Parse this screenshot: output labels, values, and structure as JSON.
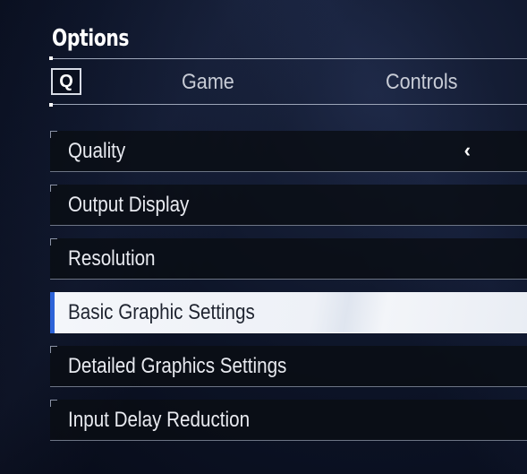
{
  "header": {
    "title": "Options"
  },
  "tabs": {
    "key_hint": "Q",
    "items": [
      {
        "label": "Game"
      },
      {
        "label": "Controls"
      }
    ]
  },
  "menu": {
    "items": [
      {
        "label": "Quality",
        "has_chevron": true,
        "chevron": "‹"
      },
      {
        "label": "Output Display"
      },
      {
        "label": "Resolution"
      },
      {
        "label": "Basic Graphic Settings",
        "selected": true
      },
      {
        "label": "Detailed Graphics Settings"
      },
      {
        "label": "Input Delay Reduction"
      }
    ]
  },
  "colors": {
    "accent": "#2d63d8",
    "row_bg": "#0a0d14",
    "selected_bg": "#f4f6fa"
  }
}
